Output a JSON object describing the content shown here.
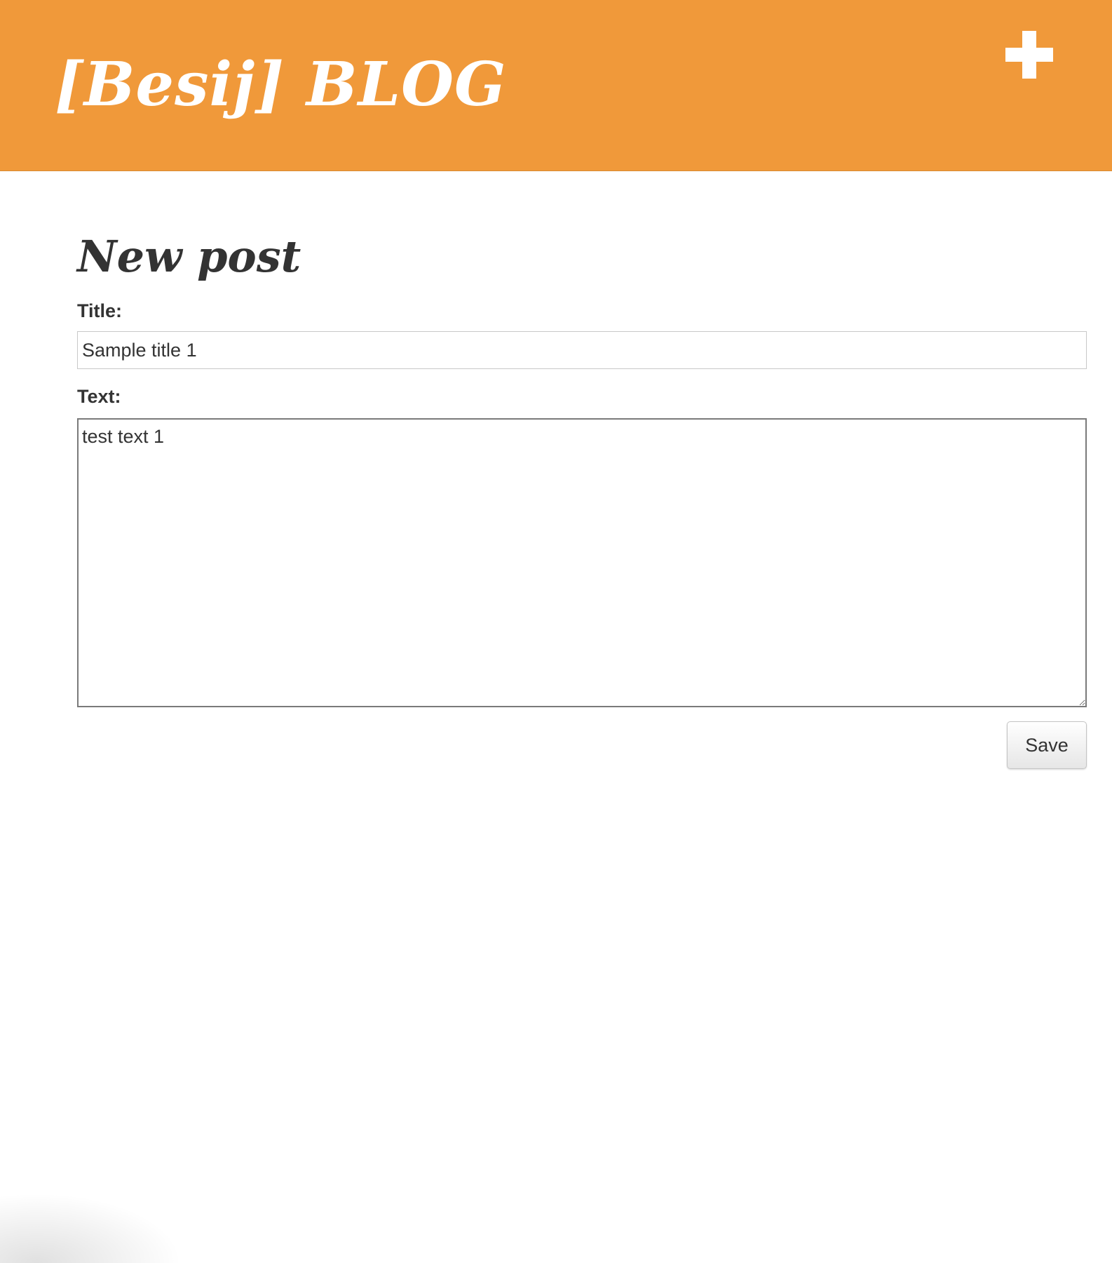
{
  "header": {
    "blog_title": "[Besij] BLOG",
    "add_icon": "plus-icon",
    "background_color": "#f0993a",
    "text_color": "#ffffff"
  },
  "form": {
    "heading": "New post",
    "title_label": "Title:",
    "title_value": "Sample title 1",
    "text_label": "Text:",
    "text_value": "test text 1",
    "save_label": "Save"
  }
}
